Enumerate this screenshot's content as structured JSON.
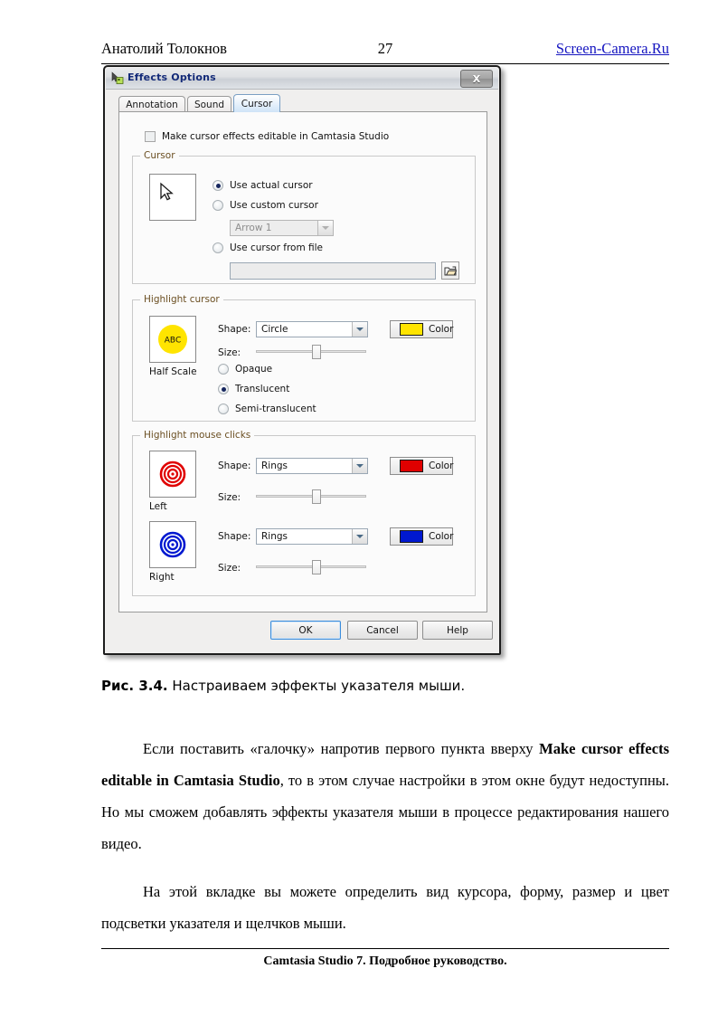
{
  "page": {
    "running_head_left": "Анатолий Толокнов",
    "page_number": "27",
    "site_link": "Screen-Camera.Ru",
    "footer": "Camtasia Studio 7. Подробное руководство."
  },
  "figure": {
    "caption_label": "Рис. 3.4.",
    "caption_text": "Настраиваем эффекты указателя мыши."
  },
  "body": {
    "paragraph_1_a": "Если поставить «галочку» напротив первого пункта вверху ",
    "paragraph_1_bold": "Make cursor effects editable in Camtasia Studio",
    "paragraph_1_b": ", то в этом случае настройки в этом окне будут недоступны. Но мы сможем добавлять эффекты указателя мыши в процессе редактирования нашего видео.",
    "paragraph_2": "На этой вкладке вы можете определить вид курсора, форму, размер и цвет подсветки указателя и щелчков мыши."
  },
  "dialog": {
    "title": "Effects Options",
    "icon": "cursor-options-icon",
    "close_label": "X",
    "tabs": [
      {
        "label": "Annotation",
        "active": false
      },
      {
        "label": "Sound",
        "active": false
      },
      {
        "label": "Cursor",
        "active": true
      }
    ],
    "editable_checkbox": {
      "label": "Make cursor effects editable in Camtasia Studio",
      "checked": false
    },
    "cursor_group": {
      "title": "Cursor",
      "preview_icon": "mouse-arrow-cursor",
      "options": [
        {
          "label": "Use actual cursor",
          "selected": true
        },
        {
          "label": "Use custom cursor",
          "selected": false
        },
        {
          "label": "Use cursor from file",
          "selected": false
        }
      ],
      "custom_cursor_combo": {
        "value": "Arrow 1",
        "enabled": false
      },
      "file_path": {
        "value": "",
        "enabled": false
      },
      "browse_icon": "open-folder-icon"
    },
    "highlight_cursor_group": {
      "title": "Highlight cursor",
      "preview_text": "ABC",
      "preview_color": "#FFE400",
      "preview_caption": "Half Scale",
      "shape_label": "Shape:",
      "shape_value": "Circle",
      "size_label": "Size:",
      "size_percent": 48,
      "color_button_label": "Color",
      "color_value": "#FFE400",
      "opacity_options": [
        {
          "label": "Opaque",
          "selected": false
        },
        {
          "label": "Translucent",
          "selected": true
        },
        {
          "label": "Semi-translucent",
          "selected": false
        }
      ]
    },
    "highlight_clicks_group": {
      "title": "Highlight mouse clicks",
      "rows": [
        {
          "preview_caption": "Left",
          "preview_icon": "concentric-rings-icon",
          "shape_label": "Shape:",
          "shape_value": "Rings",
          "size_label": "Size:",
          "size_percent": 48,
          "color_button_label": "Color",
          "color_value": "#E00000"
        },
        {
          "preview_caption": "Right",
          "preview_icon": "concentric-rings-icon",
          "shape_label": "Shape:",
          "shape_value": "Rings",
          "size_label": "Size:",
          "size_percent": 48,
          "color_button_label": "Color",
          "color_value": "#0018D0"
        }
      ]
    },
    "buttons": {
      "ok": "OK",
      "cancel": "Cancel",
      "help": "Help"
    }
  }
}
